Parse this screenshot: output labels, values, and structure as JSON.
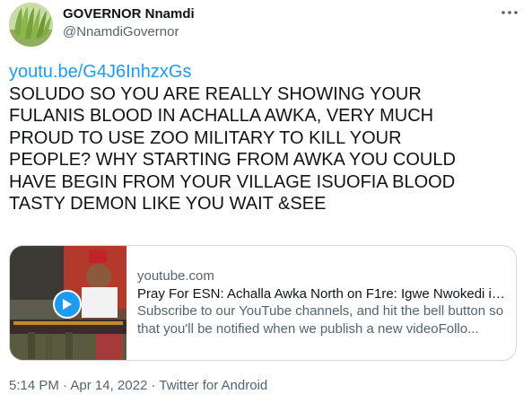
{
  "author": {
    "name": "GOVERNOR Nnamdi",
    "handle": "@NnamdiGovernor",
    "avatar_icon": "plantain-avatar-icon"
  },
  "tweet": {
    "link": "youtu.be/G4J6InhzxGs",
    "text": "SOLUDO SO YOU ARE REALLY SHOWING YOUR\nFULANIS BLOOD IN ACHALLA AWKA, VERY MUCH\nPROUD TO USE ZOO MILITARY TO KILL YOUR\nPEOPLE? WHY STARTING FROM AWKA YOU COULD\nHAVE BEGIN FROM YOUR VILLAGE ISUOFIA BLOOD\nTASTY DEMON LIKE YOU WAIT &SEE"
  },
  "card": {
    "domain": "youtube.com",
    "title": "Pray For ESN: Achalla Awka North on F1re: Igwe Nwokedi is...",
    "description": "Subscribe to our YouTube channels, and hit the bell button so that you'll be notified when we publish a new videoFollo...",
    "play_icon": "play-icon"
  },
  "meta": {
    "time": "5:14 PM",
    "separator1": " · ",
    "date": "Apr 14, 2022",
    "separator2": " · ",
    "source": "Twitter for Android"
  },
  "colors": {
    "link": "#1d9bf0",
    "secondary_text": "#536471",
    "border": "#cfd9de"
  }
}
